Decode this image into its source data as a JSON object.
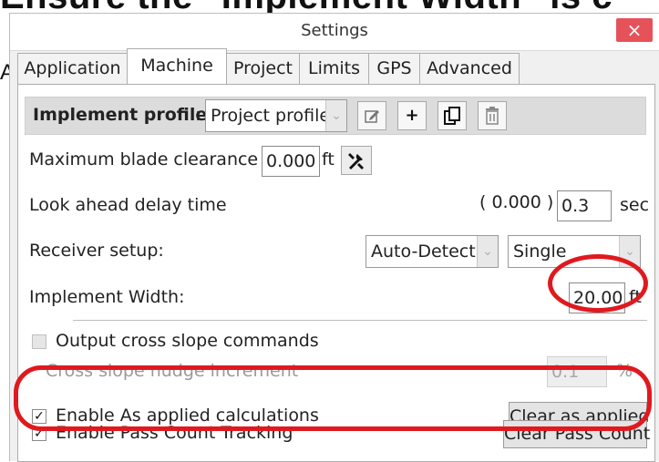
{
  "background": {
    "caption_text": "Ensure the \"Implement Width\" is c",
    "caption_fragment": "A"
  },
  "window": {
    "title": "Settings",
    "close_glyph": "×"
  },
  "tabs": [
    {
      "label": "Application"
    },
    {
      "label": "Machine"
    },
    {
      "label": "Project"
    },
    {
      "label": "Limits"
    },
    {
      "label": "GPS"
    },
    {
      "label": "Advanced"
    }
  ],
  "active_tab": "Machine",
  "implement_profile": {
    "label": "Implement profile",
    "separator": ":",
    "selected": "Project profile",
    "edit_icon": "edit-icon",
    "add_label": "+",
    "copy_icon": "copy-icon",
    "delete_icon": "trash-icon"
  },
  "blade_clearance": {
    "label": "Maximum blade clearance :",
    "value": "0.000",
    "unit": "ft",
    "tool_icon": "tools-icon"
  },
  "look_ahead": {
    "label": "Look ahead delay time",
    "readout": "( 0.000 )",
    "value": "0.3",
    "unit": "sec"
  },
  "receiver_setup": {
    "label": "Receiver setup:",
    "mode": "Auto-Detect",
    "type": "Single"
  },
  "implement_width": {
    "label": "Implement Width:",
    "value": "20.00",
    "unit": "ft"
  },
  "cross_slope": {
    "checkbox_label": "Output cross slope commands",
    "checked": false,
    "nudge_label": "Cross slope nudge increment",
    "nudge_value": "0.1",
    "nudge_unit": "%"
  },
  "as_applied": {
    "checkbox_label": "Enable As applied calculations",
    "checked": true,
    "check_glyph": "✓",
    "button_label": "Clear as applied"
  },
  "pass_count": {
    "checkbox_label": "Enable Pass Count Tracking",
    "checked": true,
    "check_glyph": "✓",
    "button_label": "Clear Pass Count"
  },
  "annotation_color": "#e0191f"
}
